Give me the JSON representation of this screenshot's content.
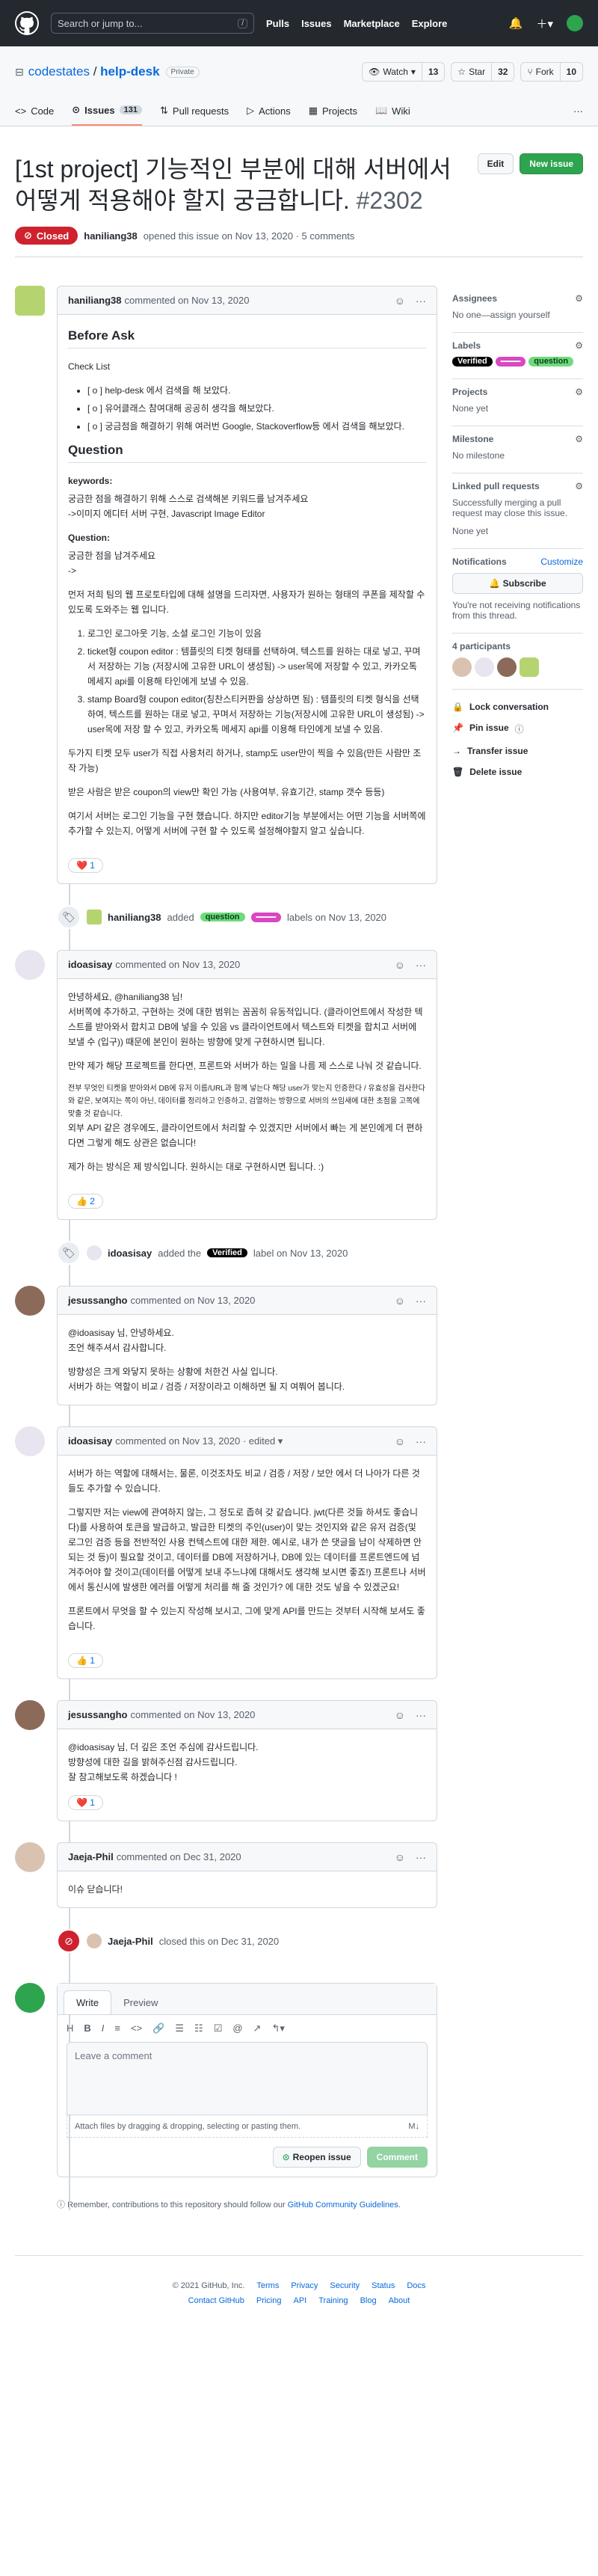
{
  "header": {
    "search_placeholder": "Search or jump to...",
    "slash": "/",
    "nav": [
      "Pulls",
      "Issues",
      "Marketplace",
      "Explore"
    ]
  },
  "repo": {
    "owner": "codestates",
    "separator": "/",
    "name": "help-desk",
    "visibility": "Private",
    "watch_label": "Watch",
    "watch_count": "13",
    "star_label": "Star",
    "star_count": "32",
    "fork_label": "Fork",
    "fork_count": "10"
  },
  "tabs": {
    "code": "Code",
    "issues": "Issues",
    "issues_count": "131",
    "pulls": "Pull requests",
    "actions": "Actions",
    "projects": "Projects",
    "wiki": "Wiki"
  },
  "issue": {
    "title": "[1st project] 기능적인 부분에 대해 서버에서 어떻게 적용해야 할지 궁금합니다.",
    "number": "#2302",
    "edit": "Edit",
    "new_issue": "New issue",
    "state": "Closed",
    "author": "haniliang38",
    "opened_text": "opened this issue on Nov 13, 2020 · 5 comments"
  },
  "comment1": {
    "author": "haniliang38",
    "meta": "commented on Nov 13, 2020",
    "h_before": "Before Ask",
    "checklist_title": "Check List",
    "checklist": [
      "[ o ] help-desk 에서 검색을 해 보았다.",
      "[ o ] 유어클래스 참여대해 공공히 생각을 해보았다.",
      "[ o ] 궁금점을 해결하기 위해 여러번 Google, Stackoverflow등 에서 검색을 해보았다."
    ],
    "h_question": "Question",
    "keywords_label": "keywords:",
    "keywords_text1": "궁금한 점을 해결하기 위해 스스로 검색해본 키워드를 남겨주세요",
    "keywords_text2": "->이미지 에디터 서버 구현, Javascript Image Editor",
    "question_label": "Question:",
    "question_text1": "궁금한 점을 남겨주세요",
    "question_text2": "->",
    "para1": "먼저 저희 팀의 웹 프로토타입에 대해 설명을 드리자면, 사용자가 원하는 형태의 쿠폰을 제작할 수 있도록 도와주는 웹 입니다.",
    "ol": [
      "로그인 로그아웃 기능, 소셜 로그인 기능이 있음",
      "ticket형 coupon editor : 템플릿의 티켓 형태를 선택하여, 텍스트를 원하는 대로 넣고, 꾸며서 저장하는 기능 (저장시에 고유한 URL이 생성됨) -> user목에 저장할 수 있고, 카카오톡 메세지 api를 이용해 타인에게 보낼 수 있음.",
      "stamp Board형 coupon editor(칭찬스티커판을 상상하면 됨) : 템플릿의 티켓 형식을 선택하여, 텍스트를 원하는 대로 넣고, 꾸며서 저장하는 기능(저장시에 고유한 URL이 생성됨) -> user목에 저장 할 수 있고, 카카오톡 메세지 api를 이용해 타인에게 보낼 수 있음."
    ],
    "para2": "두가지 티켓 모두 user가 직접 사용처리 하거나, stamp도 user만이 찍을 수 있음(만든 사람만 조작 가능)",
    "para3": "받은 사람은 받은 coupon의 view만 확인 가능 (사용여부, 유효기간, stamp 갯수 등등)",
    "para4": "여기서 서버는 로그인 기능을 구현 했습니다. 하지만 editor기능 부분에서는 어떤 기능을 서버쪽에 추가할 수 있는지, 어떻게 서버에 구현 할 수 있도록 설정해야할지 알고 싶습니다.",
    "reaction": "❤️ 1"
  },
  "event1": {
    "actor": "haniliang38",
    "text_added": "added",
    "text_labels": "labels on Nov 13, 2020"
  },
  "labels": {
    "question": "question",
    "verified": "Verified",
    "pink": "━━━━"
  },
  "comment2": {
    "author": "idoasisay",
    "meta": "commented on Nov 13, 2020",
    "p1": "안녕하세요, @haniliang38 님!",
    "p2": "서버쪽에 추가하고, 구현하는 것에 대한 범위는 꼼꼼히 유동적입니다. (클라이언트에서 작성한 텍스트를 받아와서 합치고 DB에 넣을 수 있음 vs 클라이언트에서 텍스트와 티켓을 합치고 서버에 보낼 수 (입구)) 때문에 본인이 원하는 방향에 맞게 구현하시면 됩니다.",
    "p3": "만약 제가 해당 프로젝트를 한다면, 프론트와 서버가 하는 일을 나름 제 스스로 나눠 것 같습니다.",
    "p4": "전부 무엇인 티켓을 받아와서 DB에 유저 이름/URL과 함께 넣는다 해당 user가 맞는지 인증한다 / 유효성을 검사한다 와 같은, 보여지는 쪽이 아닌, 데이터를 정리하고 인증하고, 검열하는 방향으로 서버의 쓰임새에 대한 초점을 고쪽에 맞출 것 같습니다.",
    "p5": "외부 API 같은 경우에도, 클라이언트에서 처리할 수 있겠지만 서버에서 빠는 게 본인에게 더 편하다면 그렇게 해도 상관은 없습니다!",
    "p6": "제가 하는 방식은 제 방식입니다. 원하시는 대로 구현하시면 됩니다. :)",
    "reaction": "👍 2"
  },
  "event2": {
    "actor": "idoasisay",
    "text": "added the",
    "text2": "label on Nov 13, 2020"
  },
  "comment3": {
    "author": "jesussangho",
    "meta": "commented on Nov 13, 2020",
    "p1": "@idoasisay 님, 안녕하세요.",
    "p2": "조언 해주셔서 감사합니다.",
    "p3": "방향성은 크게 와닿지 못하는 상황에 처한건 사실 입니다.",
    "p4": "서버가 하는 역할이 비교 / 검증 / 저장이라고 이해하면 될 지 여쭤어 봅니다."
  },
  "comment4": {
    "author": "idoasisay",
    "meta": "commented on Nov 13, 2020 · edited ▾",
    "p1": "서버가 하는 역할에 대해서는, 물론, 이것조차도 비교 / 검증 / 저장 / 보안 에서 더 나아가 다른 것들도 추가할 수 있습니다.",
    "p2": "그렇지만 저는 view에 관여하지 않는, 그 정도로 좁혀 갖 같습니다. jwt(다른 것들 하셔도 좋습니다)를 사용하여 토큰을 발급하고, 발급한 티켓의 주인(user)이 맞는 것인지와 같은 유저 검증(및 로그인 검증 등을 전반적인 사용 컨텍스트에 대한 제한. 예시로, 내가 쓴 댓글을 남이 삭제하면 안 되는 것 등)이 필요할 것이고, 데이터를 DB에 저장하거나, DB에 있는 데이터를 프론트엔드에 넘겨주어야 할 것이고(데이터를 어떻게 보내 주느냐에 대해서도 생각해 보시면 좋죠!) 프론트나 서버에서 통신시에 발생한 에러를 어떻게 처리를 해 줄 것인가? 에 대한 것도 넣을 수 있겠군요!",
    "p3": "프론트에서 무엇을 할 수 있는지 작성해 보시고, 그에 맞게 API를 만드는 것부터 시작해 보셔도 좋습니다.",
    "reaction": "👍 1"
  },
  "comment5": {
    "author": "jesussangho",
    "meta": "commented on Nov 13, 2020",
    "p1": "@idoasisay 님, 더 깊은 조언 주심에 감사드립니다.",
    "p2": "방향성에 대한 길을 밝혀주신점 감사드립니다.",
    "p3": "잘 참고해보도록 하겠습니다 !",
    "reaction": "❤️ 1"
  },
  "comment6": {
    "author": "Jaeja-Phil",
    "meta": "commented on Dec 31, 2020",
    "p1": "이슈 닫습니다!"
  },
  "event3": {
    "actor": "Jaeja-Phil",
    "text": "closed this on Dec 31, 2020"
  },
  "composer": {
    "write": "Write",
    "preview": "Preview",
    "tools": [
      "H",
      "B",
      "I",
      "≡",
      "<>",
      "🔗",
      "☰",
      "☷",
      "☑",
      "@",
      "↗",
      "↰▾"
    ],
    "placeholder": "Leave a comment",
    "attach": "Attach files by dragging & dropping, selecting or pasting them.",
    "md": "M↓",
    "reopen": "Reopen issue",
    "comment": "Comment"
  },
  "note": {
    "text": "Remember, contributions to this repository should follow our",
    "link": "GitHub Community Guidelines",
    "end": "."
  },
  "sidebar": {
    "assignees_title": "Assignees",
    "assignees_value": "No one—assign yourself",
    "labels_title": "Labels",
    "projects_title": "Projects",
    "projects_value": "None yet",
    "milestone_title": "Milestone",
    "milestone_value": "No milestone",
    "linked_title": "Linked pull requests",
    "linked_desc": "Successfully merging a pull request may close this issue.",
    "linked_value": "None yet",
    "notif_title": "Notifications",
    "notif_custom": "Customize",
    "subscribe": "Subscribe",
    "notif_desc": "You're not receiving notifications from this thread.",
    "participants_title": "4 participants",
    "actions": [
      "Lock conversation",
      "Pin issue",
      "Transfer issue",
      "Delete issue"
    ],
    "pin_beta": "ⓘ"
  },
  "footer": {
    "row1": [
      "© 2021 GitHub, Inc.",
      "Terms",
      "Privacy",
      "Security",
      "Status",
      "Docs"
    ],
    "row2": [
      "Contact GitHub",
      "Pricing",
      "API",
      "Training",
      "Blog",
      "About"
    ]
  },
  "colors": {
    "header_bg": "#24292f",
    "closed": "#cf222e",
    "green": "#2da44e"
  }
}
